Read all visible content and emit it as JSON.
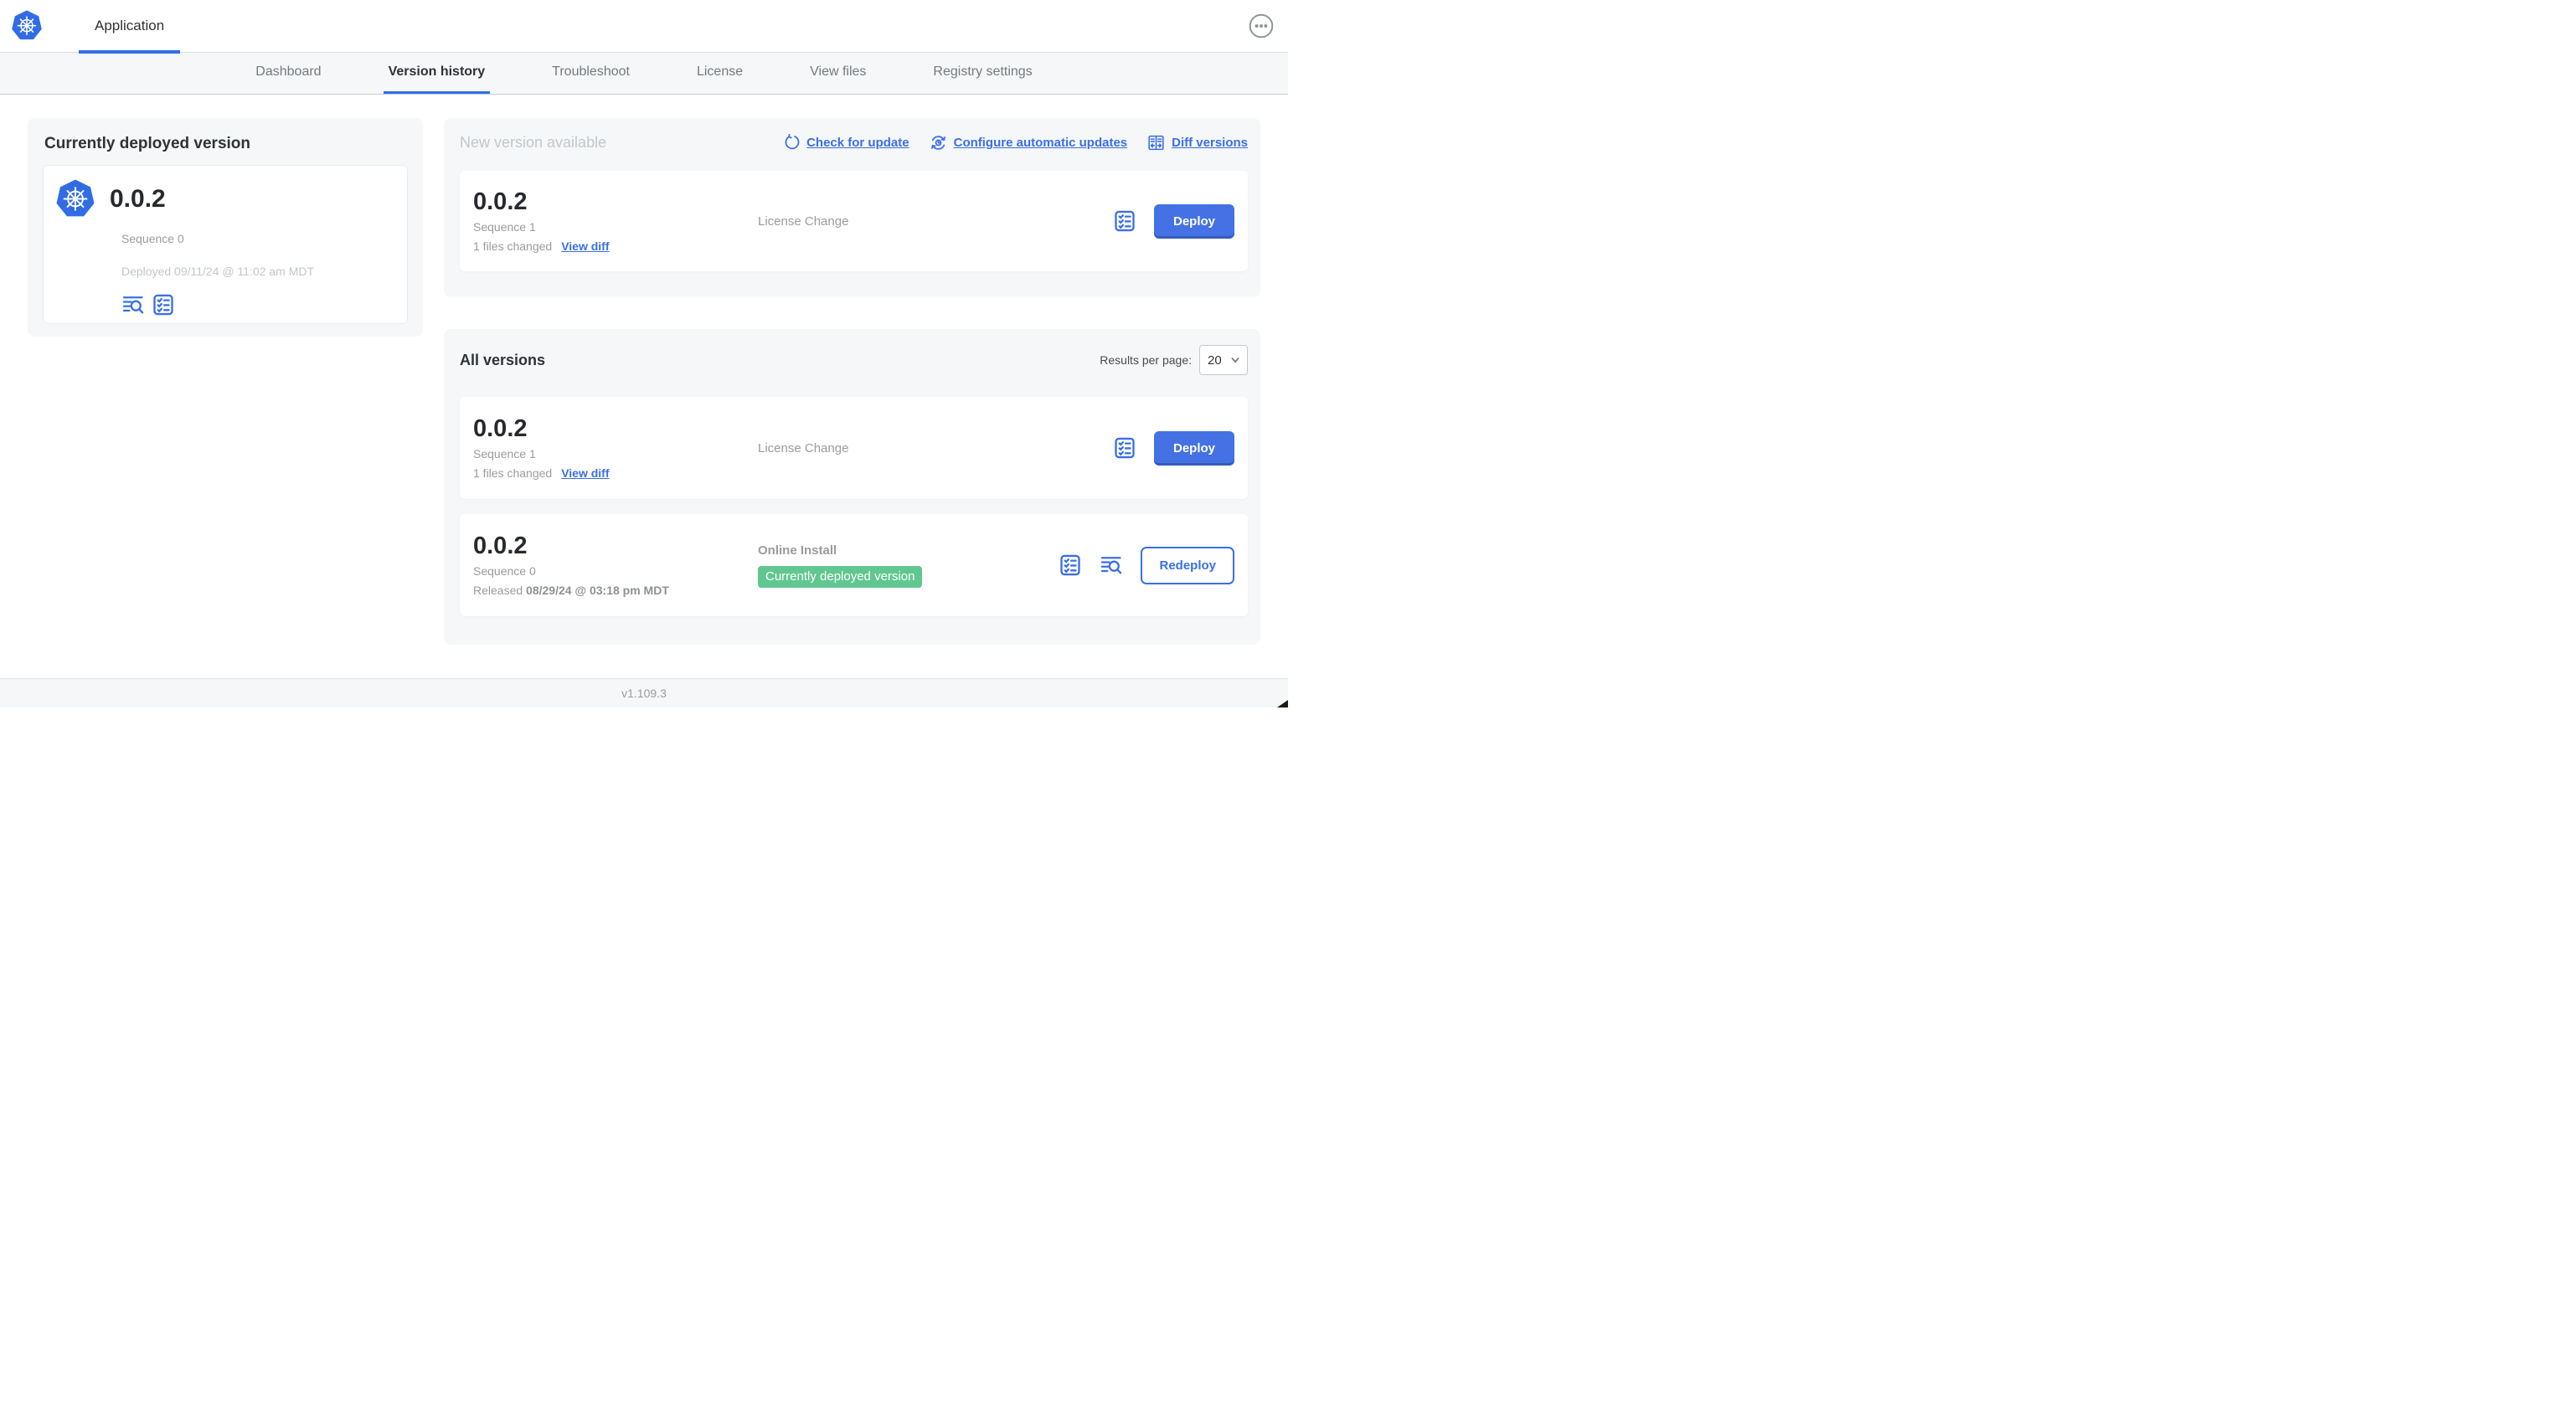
{
  "header": {
    "app_tab_label": "Application"
  },
  "nav": {
    "tabs": [
      {
        "label": "Dashboard",
        "active": false
      },
      {
        "label": "Version history",
        "active": true
      },
      {
        "label": "Troubleshoot",
        "active": false
      },
      {
        "label": "License",
        "active": false
      },
      {
        "label": "View files",
        "active": false
      },
      {
        "label": "Registry settings",
        "active": false
      }
    ]
  },
  "current_version": {
    "title": "Currently deployed version",
    "version": "0.0.2",
    "sequence": "Sequence 0",
    "deployed": "Deployed 09/11/24 @ 11:02 am MDT"
  },
  "new_version": {
    "title": "New version available",
    "check_link": "Check for update",
    "configure_link": "Configure automatic updates",
    "diff_link": "Diff versions",
    "row": {
      "version": "0.0.2",
      "sequence": "Sequence 1",
      "files_changed": "1 files changed",
      "view_diff": "View diff",
      "source": "License Change",
      "action": "Deploy"
    }
  },
  "all_versions": {
    "title": "All versions",
    "results_per_page_label": "Results per page:",
    "results_per_page_value": "20",
    "rows": [
      {
        "version": "0.0.2",
        "sequence": "Sequence 1",
        "files_changed": "1 files changed",
        "view_diff": "View diff",
        "source": "License Change",
        "action": "Deploy"
      },
      {
        "version": "0.0.2",
        "sequence": "Sequence 0",
        "released_prefix": "Released",
        "released_date": "08/29/24 @ 03:18 pm MDT",
        "source": "Online Install",
        "badge": "Currently deployed version",
        "action": "Redeploy"
      }
    ]
  },
  "footer": {
    "app_version": "v1.109.3"
  },
  "icons": {
    "logo": "kubernetes-helm-wheel",
    "more": "ellipsis-in-circle",
    "check_for_update": "circular-refresh-arrow",
    "configure_updates": "clock-with-sync-arrows",
    "diff_versions": "split-columns-with-arrows",
    "view_logs": "log-lines-with-magnifier",
    "preflight_checks": "checklist-clipboard",
    "select_caret": "chevron-down"
  },
  "colors": {
    "accent_blue": "#326de6",
    "link_blue": "#3b6fe5",
    "button_blue": "#4472e4",
    "badge_green": "#61c790",
    "section_bg": "#f5f7f9",
    "text_dark": "#2f3237",
    "text_gray": "#9b9b9b",
    "text_light_gray": "#c3c7cb"
  }
}
